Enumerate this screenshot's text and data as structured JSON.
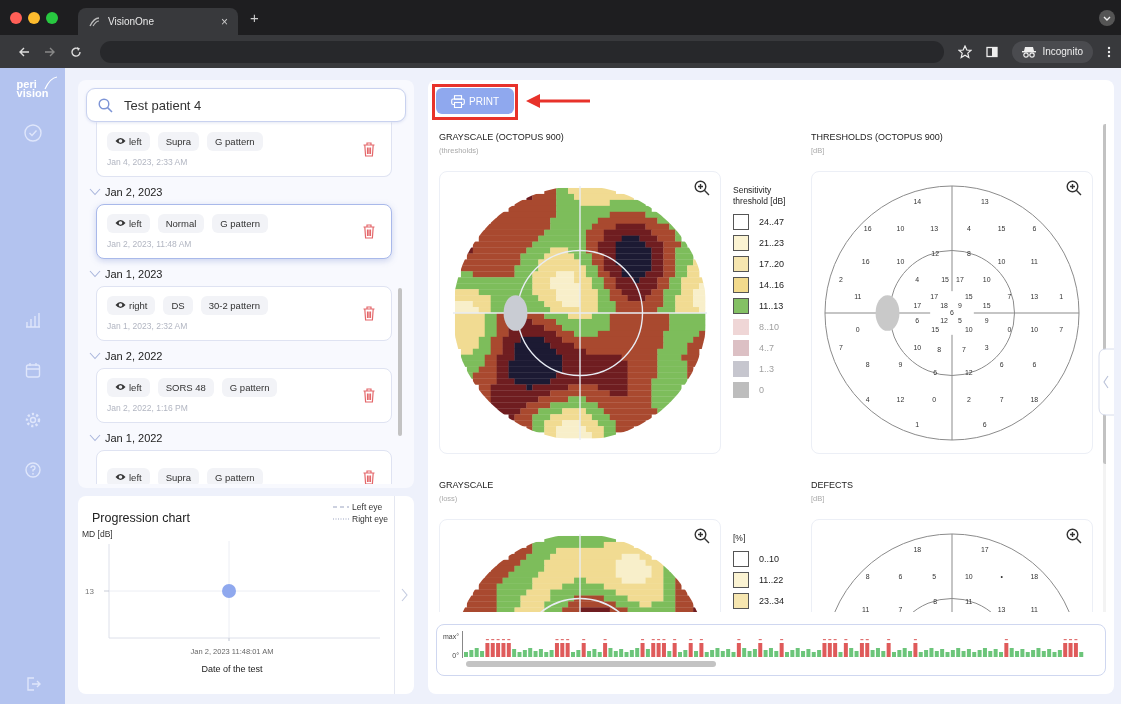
{
  "browser": {
    "tab_title": "VisionOne",
    "tab_close": "×",
    "new_tab": "+",
    "profile": "Incognito"
  },
  "sidebar": {
    "logo": [
      "peri",
      "vision"
    ]
  },
  "search": {
    "value": "Test patient 4"
  },
  "groups": [
    {
      "tests": [
        {
          "eye": "left",
          "strategy": "Supra",
          "pattern": "G pattern",
          "time": "Jan 4, 2023, 2:33 AM",
          "selected": false
        }
      ]
    },
    {
      "date": "Jan 2, 2023",
      "expanded": true,
      "tests": [
        {
          "eye": "left",
          "strategy": "Normal",
          "pattern": "G pattern",
          "time": "Jan 2, 2023, 11:48 AM",
          "selected": true
        }
      ]
    },
    {
      "date": "Jan 1, 2023",
      "expanded": true,
      "tests": [
        {
          "eye": "right",
          "strategy": "DS",
          "pattern": "30-2 pattern",
          "time": "Jan 1, 2023, 2:32 AM",
          "selected": false
        }
      ]
    },
    {
      "date": "Jan 2, 2022",
      "expanded": true,
      "tests": [
        {
          "eye": "left",
          "strategy": "SORS 48",
          "pattern": "G pattern",
          "time": "Jan 2, 2022, 1:16 PM",
          "selected": false
        }
      ]
    },
    {
      "date": "Jan 1, 2022",
      "expanded": true,
      "tests": [
        {
          "eye": "left",
          "strategy": "Supra",
          "pattern": "G pattern",
          "selected": false
        }
      ]
    }
  ],
  "progression": {
    "title": "Progression chart",
    "legend": [
      {
        "label": "Left eye",
        "kind": "dashed"
      },
      {
        "label": "Right eye",
        "kind": "dotted"
      }
    ],
    "y_label": "MD [dB]",
    "y_tick": "13",
    "x_tick": "Jan 2, 2023 11:48:01 AM",
    "x_label": "Date of the test"
  },
  "print_button": {
    "label": "PRINT"
  },
  "panels": [
    {
      "kind": "heatmap",
      "title": "GRAYSCALE (OCTOPUS 900)",
      "subtitle": "(thresholds)",
      "legend": {
        "title": "Sensitivity threshold [dB]",
        "items": [
          {
            "label": "24..47",
            "color": "#ffffff",
            "dimmed": false
          },
          {
            "label": "21..23",
            "color": "#fbf3d2",
            "dimmed": false
          },
          {
            "label": "17..20",
            "color": "#f6e6b0",
            "dimmed": false
          },
          {
            "label": "14..16",
            "color": "#f2da8c",
            "dimmed": false
          },
          {
            "label": "11..13",
            "color": "#84c064",
            "dimmed": false
          },
          {
            "label": "8..10",
            "color": "#efd6d6",
            "dimmed": true
          },
          {
            "label": "4..7",
            "color": "#dcc0c4",
            "dimmed": true
          },
          {
            "label": "1..3",
            "color": "#c6c6ce",
            "dimmed": true
          },
          {
            "label": "0",
            "color": "#bdbdbd",
            "dimmed": true
          }
        ]
      }
    },
    {
      "kind": "values",
      "title": "THRESHOLDS (OCTOPUS 900)",
      "subtitle": "[dB]",
      "values": [
        "14",
        "13",
        "16",
        "10",
        "13",
        "4",
        "15",
        "6",
        "16",
        "10",
        "12",
        "8",
        "10",
        "11",
        "2",
        "4",
        "15",
        "17",
        "10",
        "11",
        "17",
        "15",
        "7",
        "13",
        "1",
        "17",
        "18",
        "9",
        "15",
        "6",
        "6",
        "12",
        "5",
        "9",
        "0",
        "15",
        "10",
        "0",
        "10",
        "7",
        "7",
        "10",
        "8",
        "7",
        "3",
        "8",
        "9",
        "6",
        "6",
        "6",
        "12",
        "4",
        "12",
        "0",
        "2",
        "7",
        "18",
        "1",
        "6"
      ]
    },
    {
      "kind": "heatmap",
      "title": "GRAYSCALE",
      "subtitle": "(loss)",
      "legend": {
        "title": "[%]",
        "items": [
          {
            "label": "0..10",
            "color": "#ffffff",
            "dimmed": false
          },
          {
            "label": "11..22",
            "color": "#fbf3d2",
            "dimmed": false
          },
          {
            "label": "23..34",
            "color": "#f6e6b0",
            "dimmed": false
          }
        ]
      }
    },
    {
      "kind": "values",
      "title": "DEFECTS",
      "subtitle": "[dB]",
      "values": [
        "18",
        "17",
        "8",
        "6",
        "5",
        "10",
        "•",
        "18",
        "11",
        "7",
        "8",
        "11",
        "13",
        "11"
      ]
    }
  ],
  "bar_strip": {
    "y_max": "max°",
    "y_zero": "0°"
  }
}
